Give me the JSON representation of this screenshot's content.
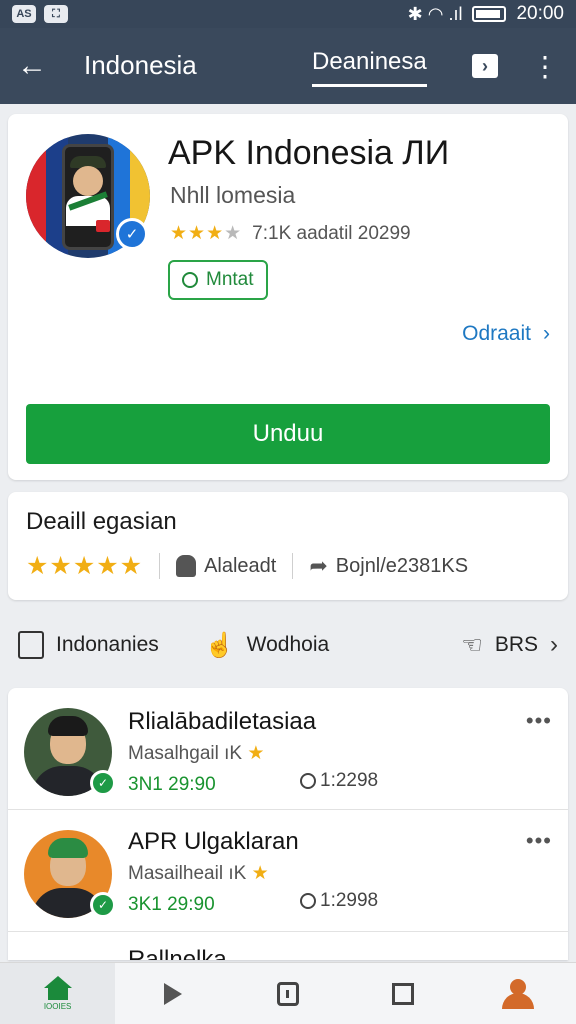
{
  "status_bar": {
    "left_chip_1": "AS",
    "left_chip_2": "⛶",
    "icons": "✱  ◠  .ıl",
    "time": "20:00"
  },
  "app_bar": {
    "title": "Indonesia",
    "tab": "Deaninesa"
  },
  "hero": {
    "title": "APK Indonesia ЛИ",
    "subtitle": "Nhll lomesia",
    "rating_stars": "★★★",
    "rating_stars_off": "★",
    "meta": "7:1K aadatil 20299",
    "chip_label": "Mntat",
    "details_link": "Odraait",
    "install_label": "Unduu"
  },
  "rating_card": {
    "title": "Deaill egasian",
    "stars": "★★★★★",
    "stat_1": "Alaleadt",
    "stat_2": "Bojnl/e2381KS"
  },
  "tabs": [
    {
      "label": "Indonanies"
    },
    {
      "label": "Wodhoia"
    },
    {
      "label": "BRS"
    }
  ],
  "list": [
    {
      "title": "Rlialābadiletasiaa",
      "subtitle": "Masalhgail ıK",
      "date": "3Ν1 29:90",
      "comments": "1:2298"
    },
    {
      "title": "APR Ulgaklaran",
      "subtitle": "Masailheail ıK",
      "date": "3Κ1 29:90",
      "comments": "1:2998"
    }
  ],
  "list_peek": "Rallnelka",
  "bottom_nav": {
    "home_label": "IOOIES"
  },
  "colors": {
    "primary_bar": "#3a495c",
    "install_green": "#17a03d",
    "link_blue": "#1e78c2",
    "star": "#f1ae14"
  }
}
